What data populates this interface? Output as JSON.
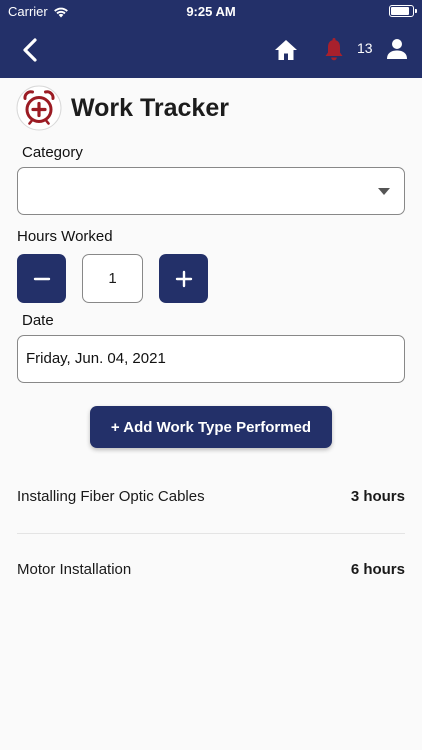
{
  "status_bar": {
    "carrier": "Carrier",
    "time": "9:25 AM",
    "battery_level": 0.95
  },
  "header": {
    "notification_count": "13"
  },
  "page": {
    "title": "Work Tracker"
  },
  "form": {
    "category_label": "Category",
    "category_value": "",
    "hours_label": "Hours Worked",
    "hours_value": "1",
    "decrement_symbol": "−",
    "increment_symbol": "+",
    "date_label": "Date",
    "date_value": "Friday, Jun. 04, 2021",
    "add_button_label": "+ Add Work Type Performed"
  },
  "work_entries": [
    {
      "type": "Installing Fiber Optic Cables",
      "hours": "3 hours"
    },
    {
      "type": "Motor Installation",
      "hours": "6 hours"
    }
  ],
  "colors": {
    "header_bg": "#233069",
    "accent": "#233069",
    "bell": "#a8202c",
    "tracker_icon": "#9b1b23"
  }
}
